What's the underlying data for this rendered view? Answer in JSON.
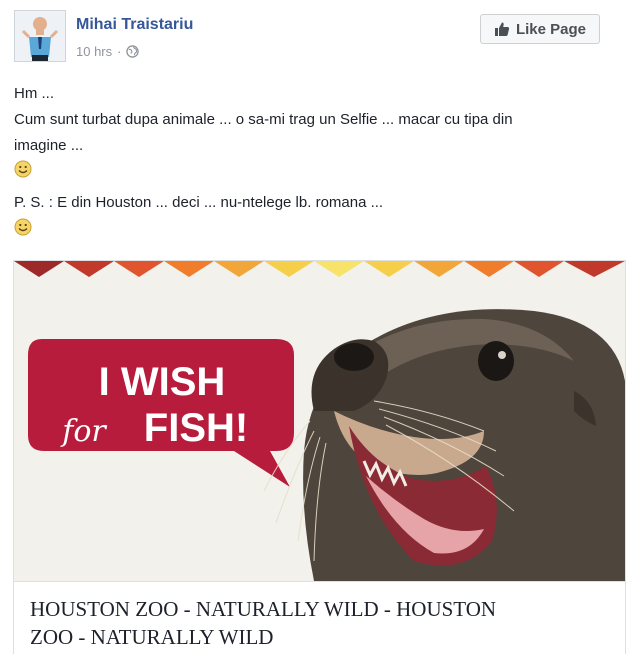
{
  "post": {
    "author": "Mihai Traistariu",
    "time": "10 hrs",
    "separator": "·",
    "privacy_icon": "globe-icon",
    "like_page_label": "Like Page",
    "lines": [
      "Hm ...",
      "Cum sunt turbat dupa animale ... o sa-mi trag un Selfie ... macar cu tipa din",
      "imagine ..."
    ],
    "ps_line": "P. S. : E din Houston ... deci ... nu-ntelege lb. romana ...",
    "emoji": "smiley-emoji-icon"
  },
  "link_preview": {
    "image_text_line1": "I WISH",
    "image_text_script": "for",
    "image_text_line2": "FISH!",
    "title_line1": "HOUSTON ZOO - NATURALLY WILD - HOUSTON",
    "title_line2": "ZOO - NATURALLY WILD",
    "colors": {
      "bubble": "#b71c3c",
      "background": "#f3f1ec",
      "seal": "#5b4f44",
      "link_blue": "#365899"
    }
  }
}
